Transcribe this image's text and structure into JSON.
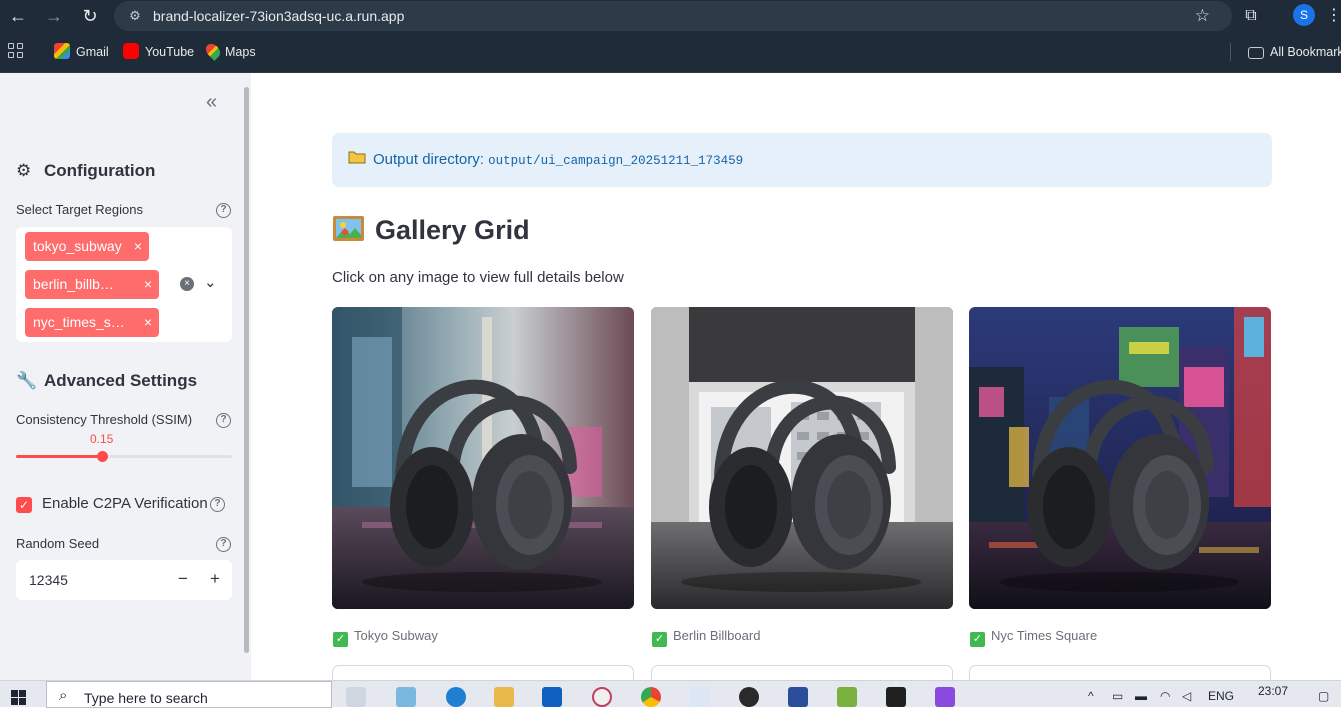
{
  "browser": {
    "url": "brand-localizer-73ion3adsq-uc.a.run.app",
    "profile_initial": "S",
    "bookmarks": [
      {
        "label": "Gmail",
        "icon": "gmail-icon",
        "color": "#ea4335"
      },
      {
        "label": "YouTube",
        "icon": "youtube-icon",
        "color": "#ff0000"
      },
      {
        "label": "Maps",
        "icon": "maps-icon",
        "color": "#34a853"
      }
    ],
    "all_bookmarks": "All Bookmarks"
  },
  "sidebar": {
    "collapse_glyph": "«",
    "configuration": {
      "title": "Configuration",
      "icon": "gear-icon"
    },
    "regions": {
      "label": "Select Target Regions",
      "chips": [
        "tokyo_subway",
        "berlin_billb…",
        "nyc_times_s…"
      ],
      "chip_color": "#ff6c6c"
    },
    "advanced": {
      "title": "Advanced Settings",
      "icon": "wrench-icon"
    },
    "ssim": {
      "label": "Consistency Threshold (SSIM)",
      "value": "0.15",
      "fraction": 0.397,
      "accent": "#ff4b4b"
    },
    "c2pa": {
      "label": "Enable C2PA Verification",
      "checked": true
    },
    "seed": {
      "label": "Random Seed",
      "value": "12345",
      "minus": "−",
      "plus": "+"
    }
  },
  "main": {
    "info": {
      "prefix": "Output directory:",
      "path": "output/ui_campaign_20251211_173459"
    },
    "gallery_title": "Gallery Grid",
    "caption": "Click on any image to view full details below",
    "cards": [
      {
        "label": "Tokyo Subway",
        "image": "headphones-tokyo-subway-image"
      },
      {
        "label": "Berlin Billboard",
        "image": "headphones-berlin-billboard-image"
      },
      {
        "label": "Nyc Times Square",
        "image": "headphones-nyc-times-square-image"
      }
    ]
  },
  "taskbar": {
    "search_placeholder": "Type here to search",
    "lang": "ENG",
    "time": "23:07"
  }
}
